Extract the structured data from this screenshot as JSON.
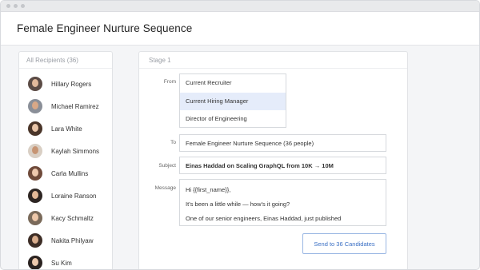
{
  "header": {
    "title": "Female Engineer Nurture Sequence"
  },
  "recipients": {
    "title": "All Recipients (36)",
    "items": [
      {
        "name": "Hillary Rogers",
        "avatar_bg": "#5b4b45",
        "avatar_face": "#e2b99b"
      },
      {
        "name": "Michael Ramirez",
        "avatar_bg": "#8a8f98",
        "avatar_face": "#d8a887"
      },
      {
        "name": "Lara White",
        "avatar_bg": "#4a3529",
        "avatar_face": "#e9c5a8"
      },
      {
        "name": "Kaylah Simmons",
        "avatar_bg": "#d9cfc4",
        "avatar_face": "#c69473"
      },
      {
        "name": "Carla Mullins",
        "avatar_bg": "#6f4a3a",
        "avatar_face": "#eec9ae"
      },
      {
        "name": "Loraine Ranson",
        "avatar_bg": "#2d2522",
        "avatar_face": "#e3b897"
      },
      {
        "name": "Kacy Schmaltz",
        "avatar_bg": "#7a6a5a",
        "avatar_face": "#edc7a9"
      },
      {
        "name": "Nakita Philyaw",
        "avatar_bg": "#3d2d26",
        "avatar_face": "#d9ad8d"
      },
      {
        "name": "Su Kim",
        "avatar_bg": "#2a2220",
        "avatar_face": "#ecc8ac"
      }
    ]
  },
  "stage": {
    "title": "Stage 1",
    "from_label": "From",
    "from_options": [
      {
        "label": "Current Recruiter",
        "selected": false
      },
      {
        "label": "Current Hiring Manager",
        "selected": true
      },
      {
        "label": "Director of Engineering",
        "selected": false
      }
    ],
    "to_label": "To",
    "to_value": "Female Engineer Nurture Sequence (36 people)",
    "subject_label": "Subject",
    "subject_value": "Einas Haddad on Scaling GraphQL from 10K → 10M",
    "message_label": "Message",
    "message_lines": [
      "Hi {{first_name}},",
      "It’s been a little while — how’s it going?",
      "One of our senior engineers, Einas Haddad, just published"
    ],
    "send_label": "Send to 36 Candidates"
  },
  "colors": {
    "accent": "#3a6fc4",
    "selected_bg": "#e5ecfa"
  }
}
